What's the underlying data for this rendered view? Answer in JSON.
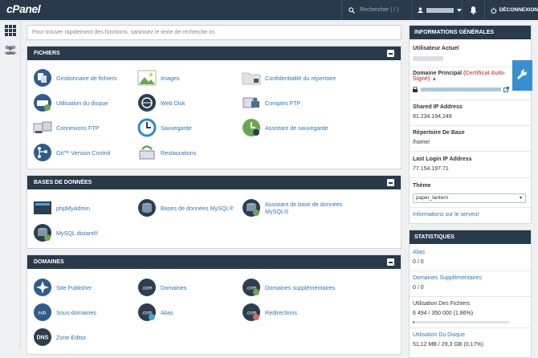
{
  "topbar": {
    "logo": "cPanel",
    "search_placeholder": "Rechercher ( / )",
    "logout": "DÉCONNEXION"
  },
  "search": {
    "placeholder": "Pour trouver rapidement des fonctions, saisissez le texte de recherche ici."
  },
  "fichiers": {
    "title": "FICHIERS",
    "items": [
      "Gestionnaire de fichiers",
      "Images",
      "Confidentialité du répertoire",
      "Utilisation du disque",
      "Web Disk",
      "Comptes FTP",
      "Connexions FTP",
      "Sauvegarde",
      "Assistant de sauvegarde",
      "Git™ Version Control",
      "Restaurations"
    ]
  },
  "bases": {
    "title": "BASES DE DONNÉES",
    "items": [
      "phpMyAdmin",
      "Bases de données MySQL®",
      "Assistant de base de données MySQL®",
      "MySQL distant®"
    ]
  },
  "domaines": {
    "title": "DOMAINES",
    "items": [
      "Site Publisher",
      "Domaines",
      "Domaines supplémentaires",
      "Sous-domaines",
      "Alias",
      "Redirections",
      "Zone Editor"
    ]
  },
  "info": {
    "title": "INFORMATIONS GÉNÉRALES",
    "user_label": "Utilisateur Actuel",
    "domain_label": "Domaine Principal",
    "cert": "(Certificat Auto-Signé)",
    "ip_label": "Shared IP Address",
    "ip": "91.234.194.249",
    "home_label": "Répertoire De Base",
    "home": "/home/",
    "last_label": "Last Login IP Address",
    "last_ip": "77.154.197.71",
    "theme_label": "Thème",
    "theme": "paper_lantern",
    "server_link": "Informations sur le serveur"
  },
  "stats": {
    "title": "STATISTIQUES",
    "alias_label": "Alias",
    "alias_val": "0 / 0",
    "dom_label": "Domaines Supplémentaires",
    "dom_val": "0 / 0",
    "files_label": "Utilisation Des Fichiers",
    "files_val": "6 494 / 350 000   (1,86%)",
    "files_pct": 1.86,
    "disk_label": "Utilisation Du Disque",
    "disk_val": "51,12 MB / 29,3 GB   (0,17%)"
  }
}
